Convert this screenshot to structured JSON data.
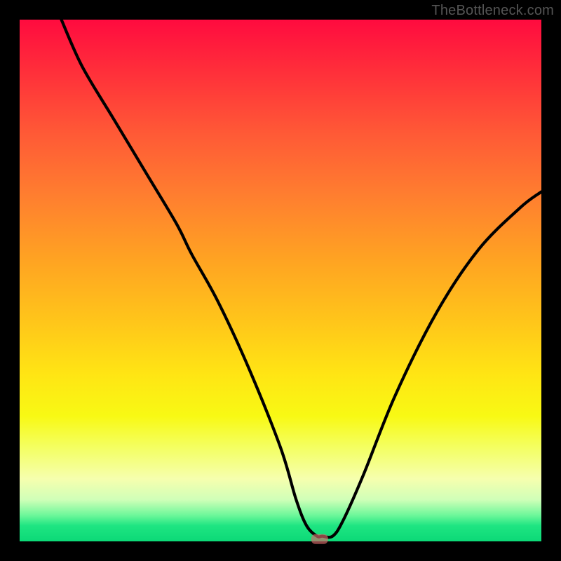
{
  "watermark": "TheBottleneck.com",
  "chart_data": {
    "type": "line",
    "title": "",
    "xlabel": "",
    "ylabel": "",
    "xlim": [
      0,
      100
    ],
    "ylim": [
      0,
      100
    ],
    "grid": false,
    "note": "Values estimated from pixel positions; axes are unlabeled. x is horizontal position (0–100), y is vertical height (0 at bottom, 100 at top).",
    "series": [
      {
        "name": "curve",
        "x": [
          8,
          12,
          18,
          24,
          30,
          33,
          38,
          44,
          50,
          53,
          55,
          57,
          58,
          60,
          62,
          66,
          72,
          80,
          88,
          96,
          100
        ],
        "y": [
          100,
          91,
          81,
          71,
          61,
          55,
          46,
          33,
          18,
          8,
          3,
          1,
          1,
          1,
          4,
          13,
          28,
          44,
          56,
          64,
          67
        ]
      }
    ],
    "minimum_marker": {
      "x": 57.5,
      "y": 0.3
    },
    "background_gradient": {
      "orientation": "vertical",
      "stops": [
        {
          "pos": 0.0,
          "color": "#ff0b3f"
        },
        {
          "pos": 0.22,
          "color": "#ff5a36"
        },
        {
          "pos": 0.46,
          "color": "#ffa322"
        },
        {
          "pos": 0.68,
          "color": "#ffe514"
        },
        {
          "pos": 0.88,
          "color": "#f6ffae"
        },
        {
          "pos": 0.95,
          "color": "#6df79a"
        },
        {
          "pos": 1.0,
          "color": "#0cd977"
        }
      ]
    }
  }
}
